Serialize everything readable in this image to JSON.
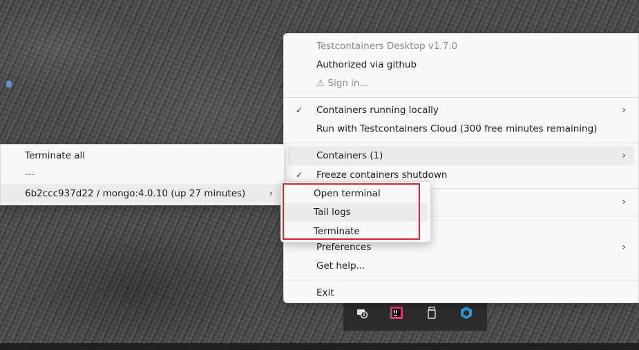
{
  "main_menu": {
    "app_version": "Testcontainers Desktop v1.7.0",
    "auth_status": "Authorized via github",
    "sign_in": "⚠ Sign in...",
    "containers_running_locally": "Containers running locally",
    "run_with_cloud": "Run with Testcontainers Cloud (300 free minutes remaining)",
    "containers": "Containers (1)",
    "freeze_shutdown": "Freeze containers shutdown",
    "preferences": "Preferences",
    "get_help": "Get help...",
    "exit": "Exit",
    "check_glyph": "✓",
    "chevron_glyph": "›"
  },
  "containers_submenu": {
    "terminate_all": "Terminate all",
    "separator_text": "---",
    "container_item": "6b2ccc937d22 / mongo:4.0.10 (up 27 minutes)"
  },
  "container_actions": {
    "open_terminal": "Open terminal",
    "tail_logs": "Tail logs",
    "terminate": "Terminate"
  },
  "colors": {
    "menu_background": "#f9f9f9",
    "highlight": "#ececec",
    "annotation_red": "#d8262e"
  }
}
